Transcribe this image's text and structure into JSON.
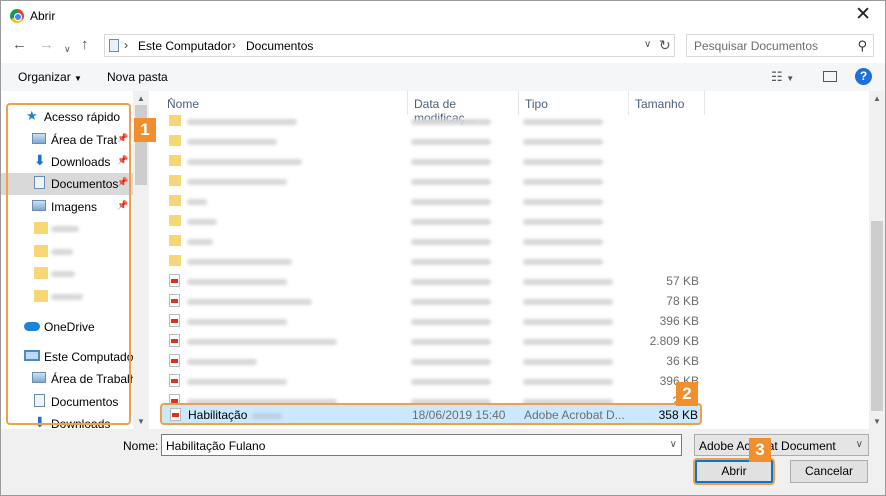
{
  "window": {
    "title": "Abrir"
  },
  "address": {
    "crumbs": [
      "Este Computador",
      "Documentos"
    ]
  },
  "search": {
    "placeholder": "Pesquisar Documentos"
  },
  "toolbar": {
    "organize": "Organizar",
    "new_folder": "Nova pasta"
  },
  "sidebar": {
    "items": [
      {
        "label": "Acesso rápido",
        "icon": "star-icon"
      },
      {
        "label": "Área de Traba",
        "icon": "desktop-icon",
        "pinned": true
      },
      {
        "label": "Downloads",
        "icon": "download-icon",
        "pinned": true
      },
      {
        "label": "Documentos",
        "icon": "document-icon",
        "pinned": true,
        "selected": true
      },
      {
        "label": "Imagens",
        "icon": "image-icon",
        "pinned": true
      },
      {
        "label": "OneDrive",
        "icon": "cloud-icon"
      },
      {
        "label": "Este Computador",
        "icon": "computer-icon"
      },
      {
        "label": "Área de Trabalho",
        "icon": "desktop-icon"
      },
      {
        "label": "Documentos",
        "icon": "document-icon"
      },
      {
        "label": "Downloads",
        "icon": "download-icon"
      }
    ]
  },
  "columns": {
    "name": "Nome",
    "date": "Data de modificaç...",
    "type": "Tipo",
    "size": "Tamanho"
  },
  "files": {
    "pdf_sizes": [
      "57 KB",
      "78 KB",
      "396 KB",
      "2.809 KB",
      "36 KB",
      "396 KB",
      "2"
    ],
    "selected": {
      "name": "Habilitação",
      "date": "18/06/2019 15:40",
      "type": "Adobe Acrobat D...",
      "size": "358 KB"
    }
  },
  "footer": {
    "name_label": "Nome:",
    "name_value": "Habilitação Fulano",
    "type_value": "Adobe Acrobat Document",
    "open": "Abrir",
    "cancel": "Cancelar"
  },
  "badges": {
    "b1": "1",
    "b2": "2",
    "b3": "3"
  },
  "colors": {
    "highlight": "#f0a04a",
    "badge": "#ef8f2e",
    "accent": "#0078d7",
    "selected_row": "#cce8ff"
  }
}
